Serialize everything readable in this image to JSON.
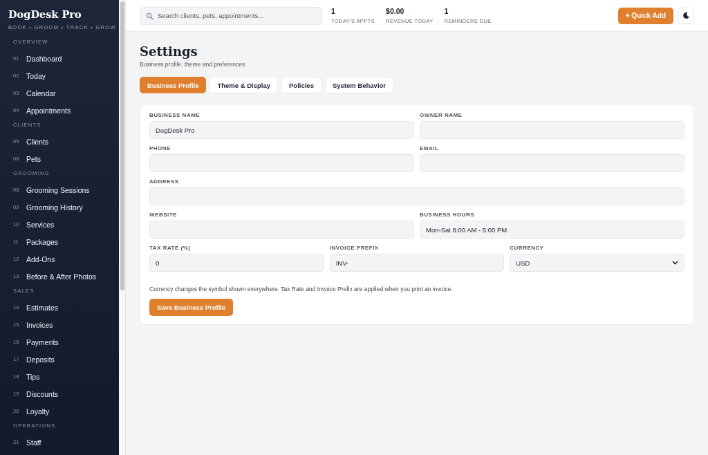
{
  "sidebar": {
    "brand": "DogDesk Pro",
    "tagline": "BOOK • GROOM • TRACK • GROW",
    "sections": [
      {
        "title": "OVERVIEW",
        "items": [
          {
            "num": "01",
            "label": "Dashboard"
          },
          {
            "num": "02",
            "label": "Today"
          },
          {
            "num": "03",
            "label": "Calendar"
          },
          {
            "num": "04",
            "label": "Appointments"
          }
        ]
      },
      {
        "title": "CLIENTS",
        "items": [
          {
            "num": "05",
            "label": "Clients"
          },
          {
            "num": "06",
            "label": "Pets"
          }
        ]
      },
      {
        "title": "GROOMING",
        "items": [
          {
            "num": "08",
            "label": "Grooming Sessions"
          },
          {
            "num": "09",
            "label": "Grooming History"
          },
          {
            "num": "10",
            "label": "Services"
          },
          {
            "num": "11",
            "label": "Packages"
          },
          {
            "num": "12",
            "label": "Add-Ons"
          },
          {
            "num": "13",
            "label": "Before & After Photos"
          }
        ]
      },
      {
        "title": "SALES",
        "items": [
          {
            "num": "14",
            "label": "Estimates"
          },
          {
            "num": "15",
            "label": "Invoices"
          },
          {
            "num": "16",
            "label": "Payments"
          },
          {
            "num": "17",
            "label": "Deposits"
          },
          {
            "num": "18",
            "label": "Tips"
          },
          {
            "num": "19",
            "label": "Discounts"
          },
          {
            "num": "20",
            "label": "Loyalty"
          }
        ]
      },
      {
        "title": "OPERATIONS",
        "items": [
          {
            "num": "21",
            "label": "Staff"
          }
        ]
      }
    ]
  },
  "topbar": {
    "search": {
      "placeholder": "Search clients, pets, appointments..."
    },
    "stats": [
      {
        "value": "1",
        "label": "TODAY'S APPTS"
      },
      {
        "value": "$0.00",
        "label": "REVENUE TODAY"
      },
      {
        "value": "1",
        "label": "REMINDERS DUE"
      }
    ],
    "quick_add": "+ Quick Add"
  },
  "page": {
    "title": "Settings",
    "subtitle": "Business profile, theme and preferences",
    "tabs": [
      {
        "label": "Business Profile",
        "selected": true
      },
      {
        "label": "Theme & Display",
        "selected": false
      },
      {
        "label": "Policies",
        "selected": false
      },
      {
        "label": "System Behavior",
        "selected": false
      }
    ],
    "field_rows": [
      [
        {
          "label": "BUSINESS NAME",
          "value": "DogDesk Pro",
          "kind": "text"
        },
        {
          "label": "OWNER NAME",
          "kind": "text"
        }
      ],
      [
        {
          "label": "PHONE",
          "kind": "text"
        },
        {
          "label": "EMAIL",
          "kind": "text"
        }
      ],
      [
        {
          "label": "ADDRESS",
          "kind": "text"
        }
      ],
      [
        {
          "label": "WEBSITE",
          "kind": "text"
        },
        {
          "label": "BUSINESS HOURS",
          "value": "Mon-Sat 8:00 AM - 5:00 PM",
          "kind": "text"
        }
      ],
      [
        {
          "label": "TAX RATE (%)",
          "value": "0",
          "kind": "text"
        },
        {
          "label": "INVOICE PREFIX",
          "value": "INV-",
          "kind": "text"
        },
        {
          "label": "CURRENCY",
          "value": "USD",
          "kind": "select"
        }
      ]
    ],
    "note": "Currency changes the symbol shown everywhere. Tax Rate and Invoice Prefix are applied when you print an invoice.",
    "save": "Save Business Profile"
  }
}
